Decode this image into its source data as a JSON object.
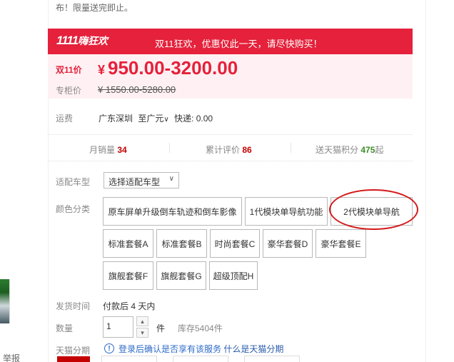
{
  "top_note": "布！限量送完即止。",
  "promo": {
    "logo": "1111",
    "logo_text": "嗨狂欢",
    "text": "双11狂欢，优惠仅此一天，请尽快购买！",
    "price_label": "双11价",
    "price_currency": "¥",
    "price": "950.00-3200.00",
    "orig_label": "专柜价",
    "orig_price": "¥ 1550.00-5280.00"
  },
  "shipping": {
    "label": "运费",
    "origin": "广东深圳",
    "to": "至广元",
    "method": "快递: 0.00"
  },
  "stats": {
    "monthly_label": "月销量",
    "monthly_value": "34",
    "reviews_label": "累计评价",
    "reviews_value": "86",
    "points_label": "送天猫积分",
    "points_value": "475",
    "points_suffix": "起"
  },
  "car_model": {
    "label": "适配车型",
    "placeholder": "选择适配车型"
  },
  "colors": {
    "label": "颜色分类",
    "options": [
      "原车屏单升级倒车轨迹和倒车影像",
      "1代模块单导航功能",
      "2代模块单导航",
      "标准套餐A",
      "标准套餐B",
      "时尚套餐C",
      "豪华套餐D",
      "豪华套餐E",
      "旗舰套餐F",
      "旗舰套餐G",
      "超级顶配H"
    ]
  },
  "delivery": {
    "label": "发货时间",
    "value": "付款后 4 天内"
  },
  "quantity": {
    "label": "数量",
    "value": "1",
    "unit": "件",
    "stock": "库存5404件"
  },
  "installment": {
    "label": "天猫分期",
    "login_text": "登录后确认是否享有该服务",
    "link": "什么是天猫分期"
  },
  "sidebar": {
    "report": "举报"
  },
  "colors_theme": {
    "accent": "#e5213b",
    "link": "#2d6bc9"
  }
}
